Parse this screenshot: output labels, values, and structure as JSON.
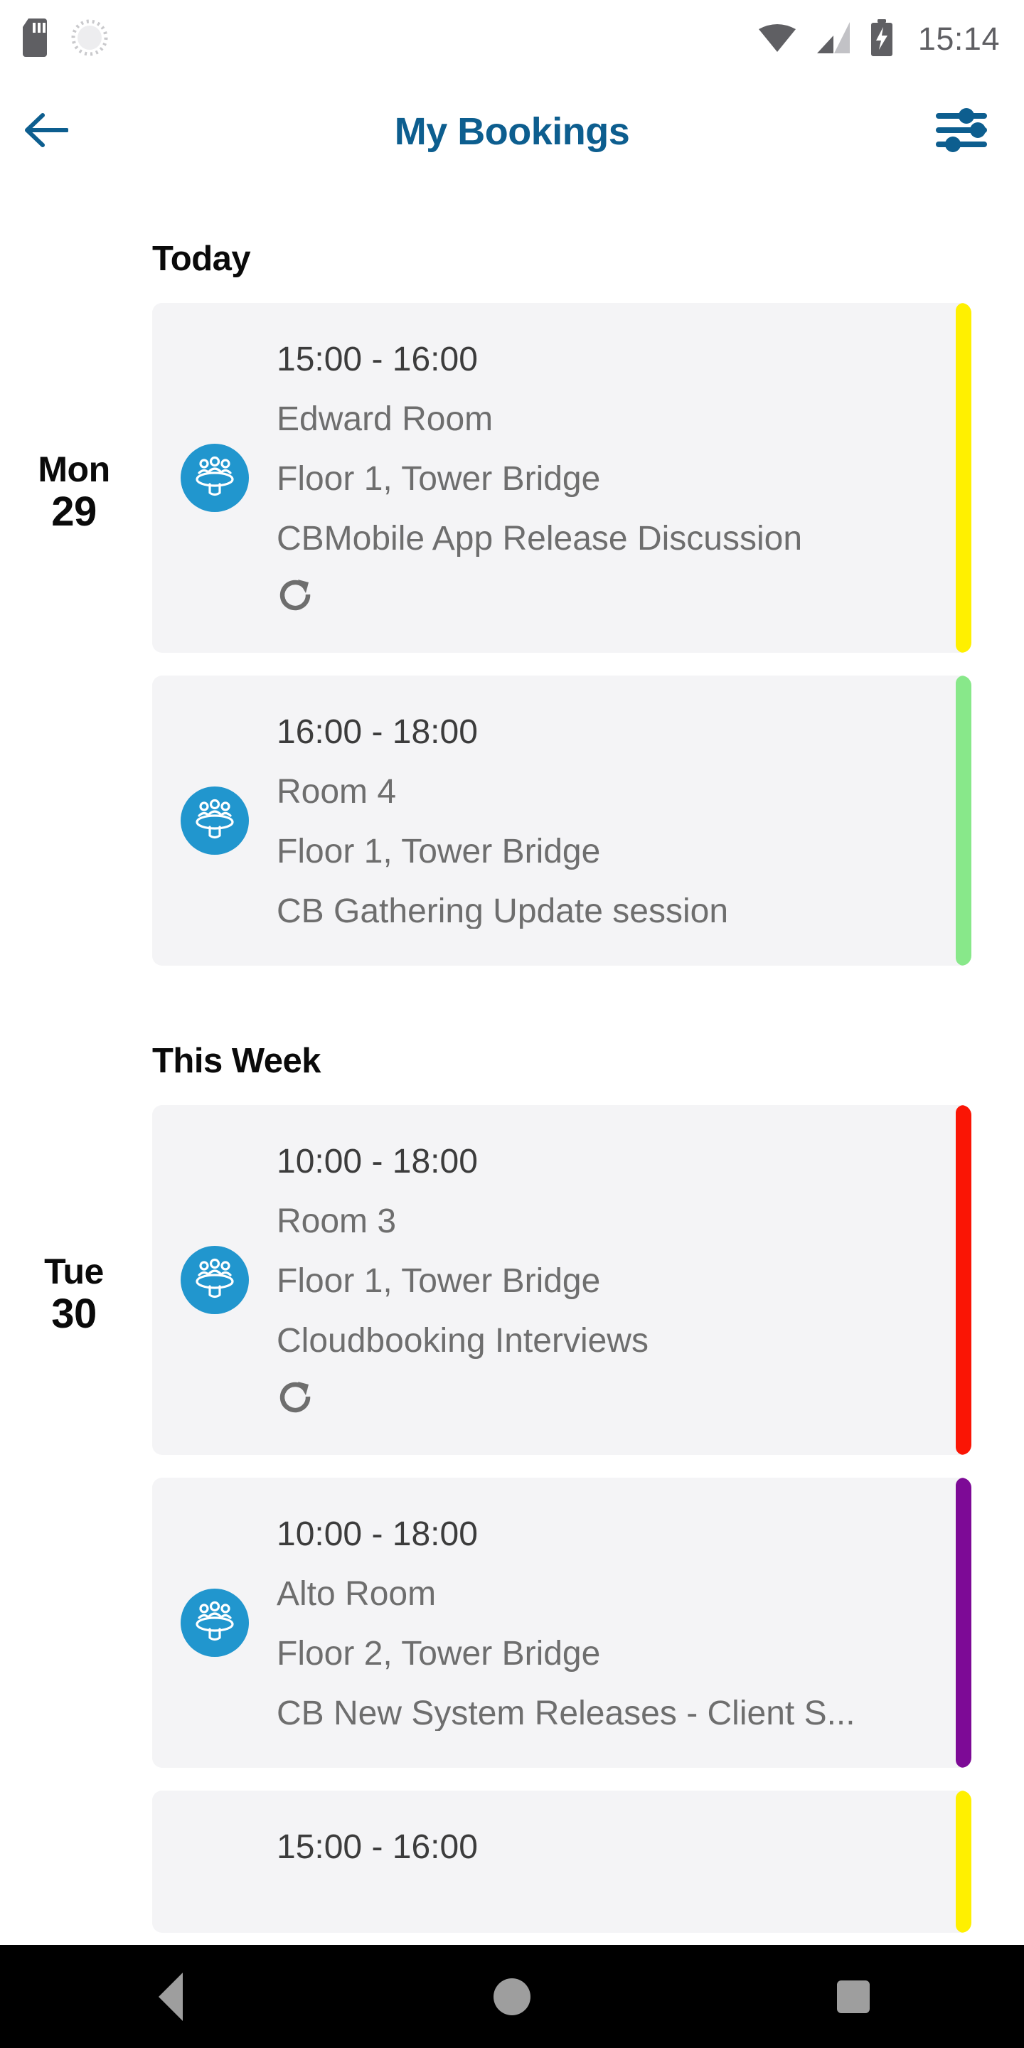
{
  "status_bar": {
    "icons": [
      "sd-card-icon",
      "alarm-icon",
      "wifi-icon",
      "cellular-signal-icon",
      "battery-charging-icon"
    ],
    "time": "15:14"
  },
  "header": {
    "back_icon": "back-arrow-icon",
    "title": "My Bookings",
    "filter_icon": "filter-sliders-icon",
    "accent_color": "#0D5E8F"
  },
  "colors": {
    "card_bg": "#F4F4F6",
    "room_icon_bg": "#2196CE",
    "time_text": "#3C3C3C",
    "detail_text": "#6E6E6E",
    "heading_text": "#0A0A0A",
    "stripe_yellow": "#FFF000",
    "stripe_green": "#88E88A",
    "stripe_red": "#FA1505",
    "stripe_purple": "#7D0A96"
  },
  "sections": [
    {
      "title": "Today",
      "days": [
        {
          "day_of_week": "Mon",
          "day_number": "29",
          "bookings": [
            {
              "time": "15:00 - 16:00",
              "room": "Edward Room",
              "location": "Floor 1, Tower Bridge",
              "subject": "CBMobile App Release Discussion",
              "recurring": true,
              "recurring_icon": "recurring-refresh-icon",
              "room_icon": "meeting-room-people-icon",
              "stripe_color": "#FFF000"
            },
            {
              "time": "16:00 - 18:00",
              "room": "Room 4",
              "location": "Floor 1, Tower Bridge",
              "subject": "CB Gathering Update session",
              "recurring": false,
              "room_icon": "meeting-room-people-icon",
              "stripe_color": "#88E88A"
            }
          ]
        }
      ]
    },
    {
      "title": "This Week",
      "days": [
        {
          "day_of_week": "Tue",
          "day_number": "30",
          "bookings": [
            {
              "time": "10:00 - 18:00",
              "room": "Room 3",
              "location": "Floor 1, Tower Bridge",
              "subject": "Cloudbooking Interviews",
              "recurring": true,
              "recurring_icon": "recurring-refresh-icon",
              "room_icon": "meeting-room-people-icon",
              "stripe_color": "#FA1505"
            },
            {
              "time": "10:00 - 18:00",
              "room": "Alto Room",
              "location": "Floor 2, Tower Bridge",
              "subject": "CB New System Releases - Client S...",
              "recurring": false,
              "room_icon": "meeting-room-people-icon",
              "stripe_color": "#7D0A96"
            },
            {
              "time": "15:00 - 16:00",
              "room": "",
              "location": "",
              "subject": "",
              "recurring": false,
              "partial": true,
              "stripe_color": "#FFF000"
            }
          ]
        }
      ]
    }
  ],
  "nav_bar": {
    "back_label": "back-triangle-icon",
    "home_label": "home-circle-icon",
    "recents_label": "recents-square-icon"
  }
}
